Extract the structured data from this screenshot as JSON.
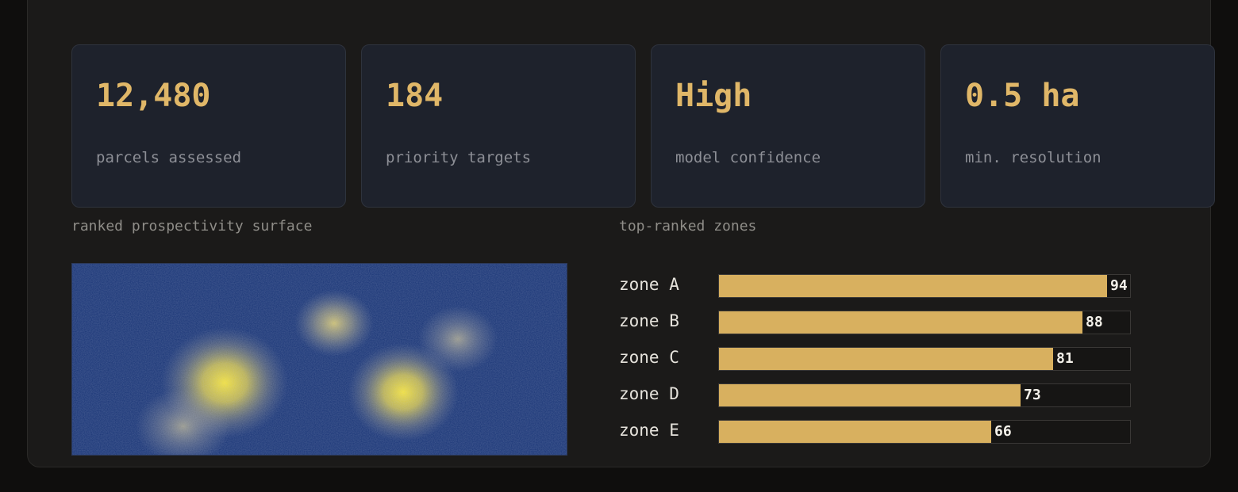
{
  "stats": [
    {
      "value": "12,480",
      "label": "parcels assessed"
    },
    {
      "value": "184",
      "label": "priority targets"
    },
    {
      "value": "High",
      "label": "model confidence"
    },
    {
      "value": "0.5 ha",
      "label": "min. resolution"
    }
  ],
  "heatmap": {
    "label": "ranked prospectivity surface"
  },
  "colors": {
    "accent": "#d8b05f",
    "value_text": "#e0b768",
    "heatmap_low": "#163274",
    "heatmap_high": "#f5e33a"
  },
  "chart_data": {
    "type": "bar",
    "title": "top-ranked zones",
    "orientation": "horizontal",
    "categories": [
      "zone A",
      "zone B",
      "zone C",
      "zone D",
      "zone E"
    ],
    "values": [
      94,
      88,
      81,
      73,
      66
    ],
    "xlim": [
      0,
      100
    ],
    "grid": false,
    "data_labels": true
  }
}
